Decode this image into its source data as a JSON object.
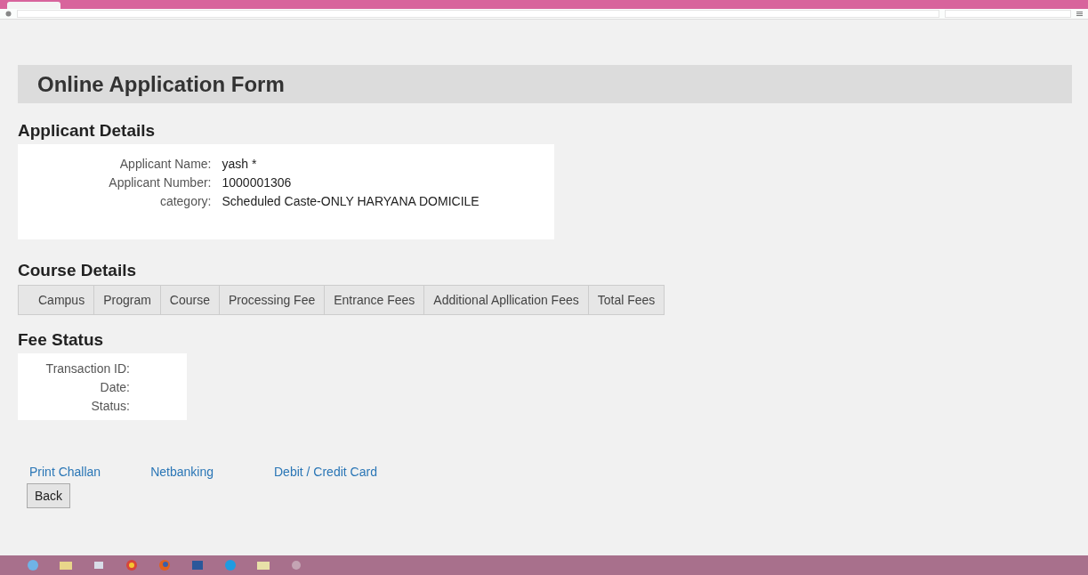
{
  "page_title": "Online Application Form",
  "applicant_details": {
    "heading": "Applicant Details",
    "fields": [
      {
        "label": "Applicant Name:",
        "value": "yash  *"
      },
      {
        "label": "Applicant Number:",
        "value": "1000001306"
      },
      {
        "label": "category:",
        "value": "Scheduled Caste-ONLY HARYANA DOMICILE"
      }
    ]
  },
  "course_details": {
    "heading": "Course Details",
    "columns": [
      "Campus",
      "Program",
      "Course",
      "Processing Fee",
      "Entrance Fees",
      "Additional Apllication Fees",
      "Total Fees"
    ]
  },
  "fee_status": {
    "heading": "Fee Status",
    "fields": [
      {
        "label": "Transaction ID:"
      },
      {
        "label": "Date:"
      },
      {
        "label": "Status:"
      }
    ]
  },
  "payment_links": [
    "Print Challan",
    "Netbanking",
    "Debit / Credit Card"
  ],
  "buttons": [
    "Back"
  ]
}
